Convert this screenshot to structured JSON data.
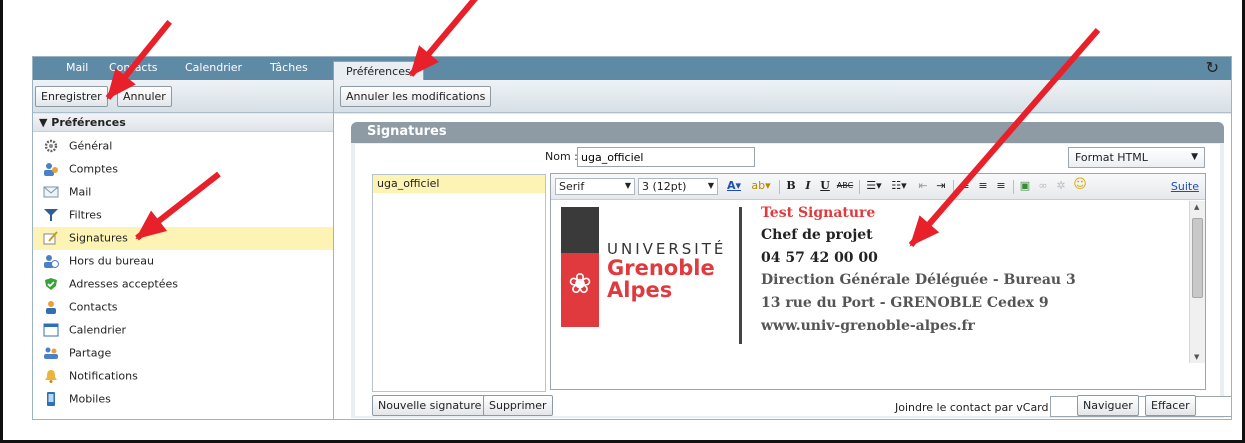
{
  "topbar": {
    "tabs": [
      {
        "label": "Mail"
      },
      {
        "label": "Contacts"
      },
      {
        "label": "Calendrier"
      },
      {
        "label": "Tâches"
      },
      {
        "label": "Préférences",
        "active": true
      }
    ],
    "refresh_icon": "refresh-icon"
  },
  "toolbar": {
    "save_label": "Enregistrer",
    "cancel_label": "Annuler",
    "undo_label": "Annuler les modifications"
  },
  "sidebar": {
    "header": "Préférences",
    "items": [
      {
        "label": "Général",
        "icon": "gear-icon"
      },
      {
        "label": "Comptes",
        "icon": "accounts-icon"
      },
      {
        "label": "Mail",
        "icon": "envelope-icon"
      },
      {
        "label": "Filtres",
        "icon": "filter-icon"
      },
      {
        "label": "Signatures",
        "icon": "signature-icon",
        "selected": true
      },
      {
        "label": "Hors du bureau",
        "icon": "out-of-office-icon"
      },
      {
        "label": "Adresses acceptées",
        "icon": "shield-check-icon"
      },
      {
        "label": "Contacts",
        "icon": "contact-icon"
      },
      {
        "label": "Calendrier",
        "icon": "calendar-icon"
      },
      {
        "label": "Partage",
        "icon": "share-icon"
      },
      {
        "label": "Notifications",
        "icon": "bell-icon"
      },
      {
        "label": "Mobiles",
        "icon": "mobile-icon"
      }
    ]
  },
  "signatures": {
    "title": "Signatures",
    "nom_label": "Nom :",
    "nom_value": "uga_officiel",
    "format": "Format HTML",
    "list": [
      "uga_officiel"
    ],
    "font": "Serif",
    "size": "3 (12pt)",
    "suite": "Suite",
    "new_button": "Nouvelle signature",
    "delete_button": "Supprimer",
    "vcard_label": "Joindre le contact par vCard :",
    "vcard_value": "",
    "browse_button": "Naviguer",
    "clear_button": "Effacer"
  },
  "logo": {
    "univ": "UNIVERSITÉ",
    "line1": "Grenoble",
    "line2": "Alpes"
  },
  "signature_body": [
    "Test Signature",
    "Chef de projet",
    "04 57 42 00 00",
    "Direction Générale Déléguée - Bureau 3",
    "13 rue du Port - GRENOBLE Cedex 9",
    "www.univ-grenoble-alpes.fr"
  ],
  "colors": {
    "accent_red": "#e03a3e",
    "tabbar": "#5f8aa5",
    "selected": "#fdf3b4",
    "arrow": "#e8202a"
  }
}
